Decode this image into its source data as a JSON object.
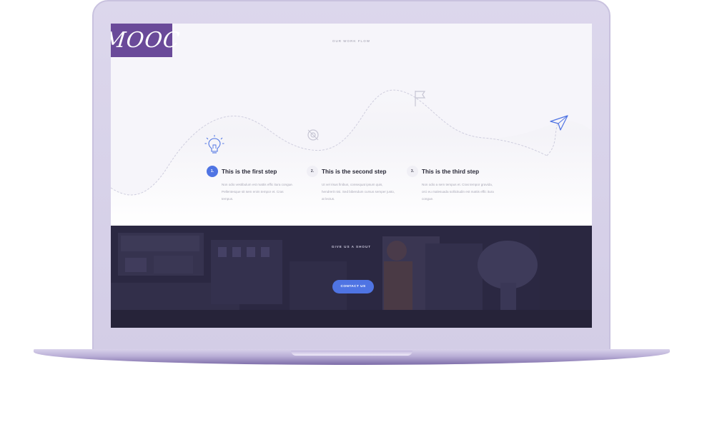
{
  "logo": {
    "text": "MOOC",
    "color": "#6a4a99"
  },
  "hero": {
    "kicker": "OUR WORK FLOW",
    "steps": [
      {
        "number": "1.",
        "title": "This is the first step",
        "body": "Non odio vestibulum est mattis effic itura congue. Pellentesque sit sem enim tempor et. Cras tempus.",
        "icon": "lightbulb-icon",
        "active": true
      },
      {
        "number": "2.",
        "title": "This is the second step",
        "body": "Ut vel risus finibus, consequat ipsum quis, hendrerit nisi. Sed bibendum cursus semper justo, at lectus.",
        "icon": "target-icon",
        "active": false
      },
      {
        "number": "3.",
        "title": "This is the third step",
        "body": "Non odio a sem tempus et. Cras tempor gravida, orci eu malesuada sollicitudin est mattis effic itura congue.",
        "icon": "flag-icon",
        "active": false
      }
    ],
    "end_icon": "paper-plane-icon"
  },
  "cta": {
    "kicker": "GIVE US A SHOUT",
    "button_label": "CONTACT US",
    "button_color": "#4f74e3"
  },
  "colors": {
    "accent": "#4f74e3",
    "band": "#2d2a45",
    "frame": "#d8d3ea"
  }
}
